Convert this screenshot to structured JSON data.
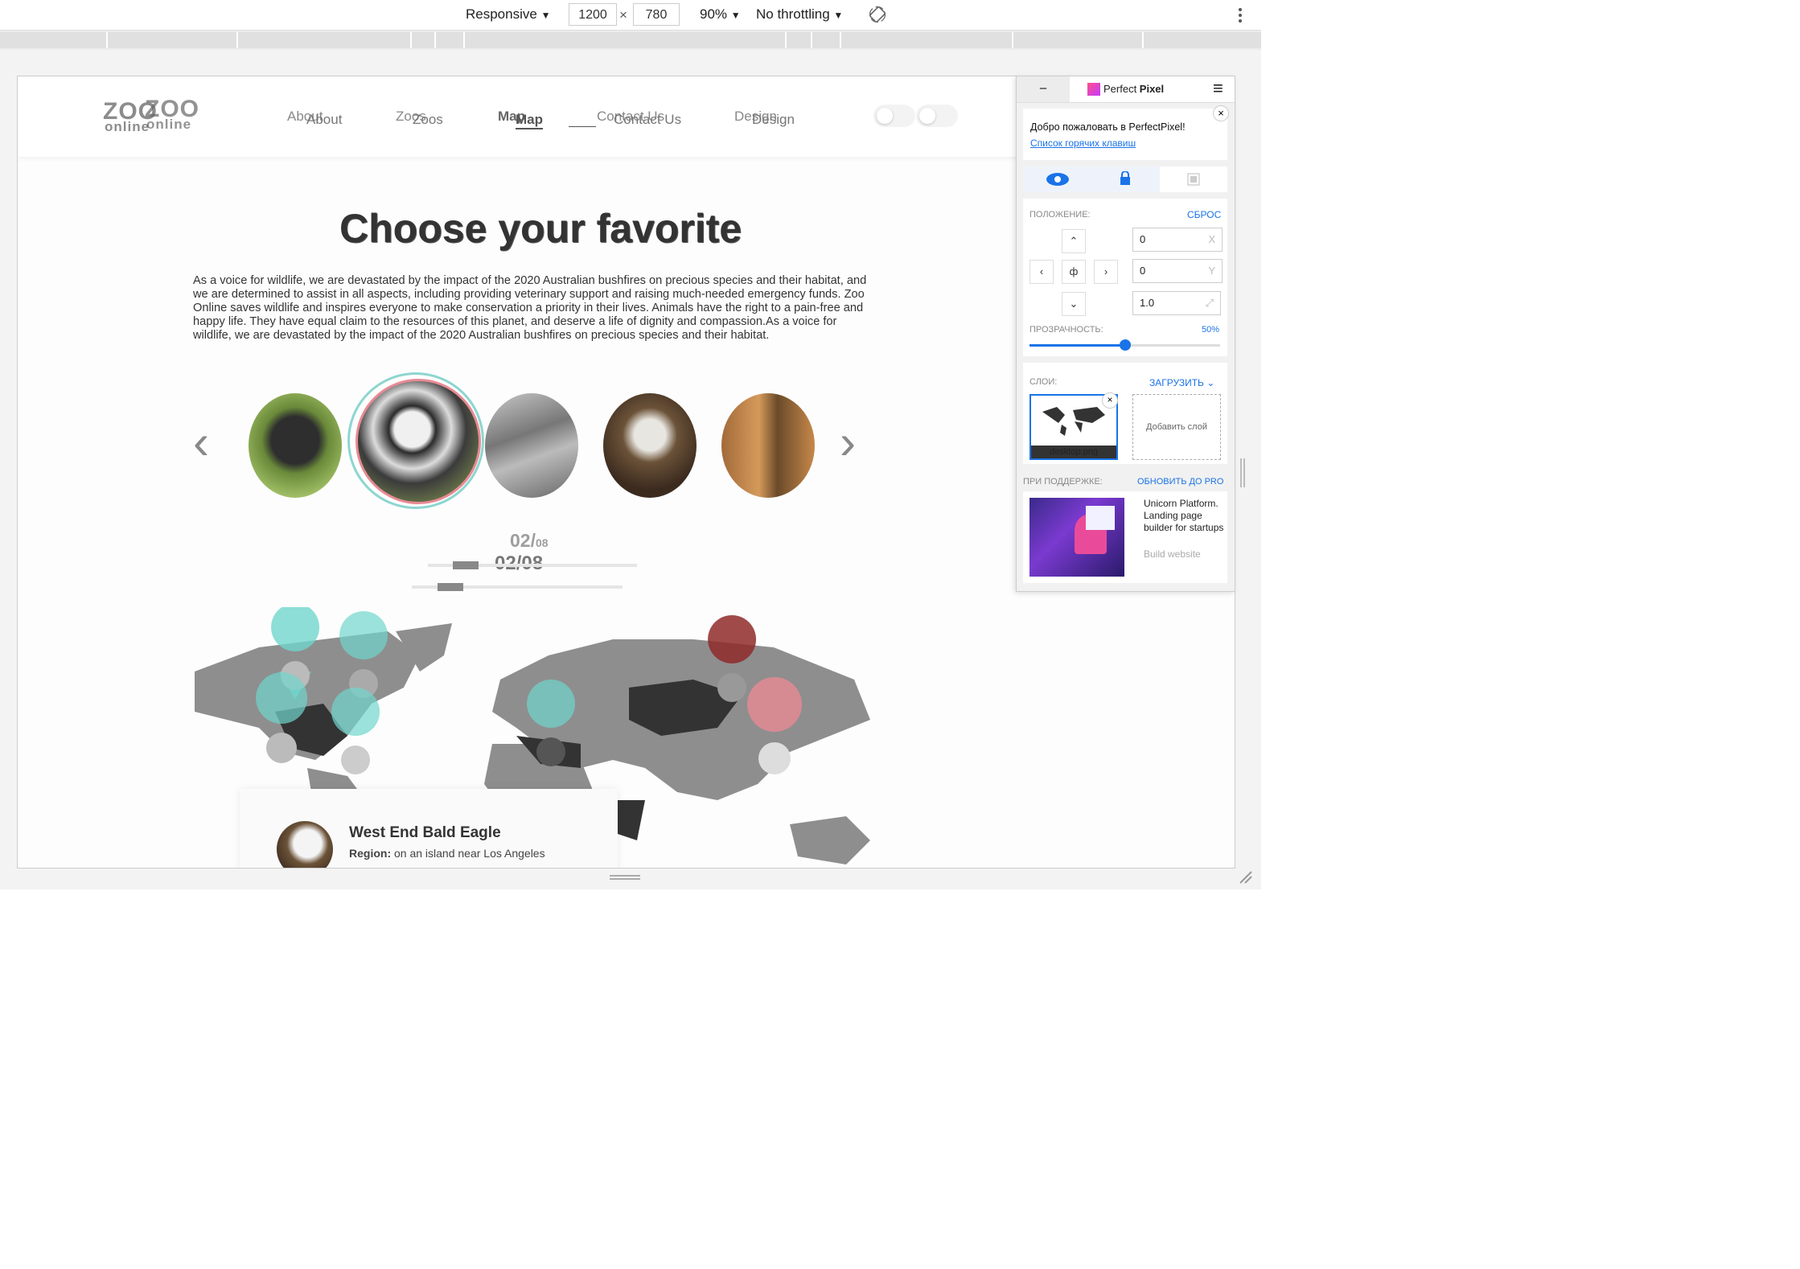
{
  "devtools": {
    "device": "Responsive",
    "width": "1200",
    "height": "780",
    "times": "×",
    "zoom": "90%",
    "throttling": "No throttling",
    "dropdown_glyph": "▼"
  },
  "site": {
    "logo_top": "ZOO",
    "logo_bottom": "online",
    "nav": [
      "About",
      "Zoos",
      "Map",
      "Contact Us",
      "Design"
    ],
    "title": "Choose your favorite",
    "paragraph": "As a voice for wildlife, we are devastated by the impact of the 2020 Australian bushfires on precious species and their habitat, and we are determined to assist in all aspects, including providing veterinary support and raising much-needed emergency funds. Zoo Online saves wildlife and inspires everyone to make conservation a priority in their lives. Animals have the right to a pain-free and happy life. They have equal claim to the resources of this planet, and deserve a life of dignity and compassion.As a voice for wildlife, we are devastated by the impact of the 2020 Australian bushfires on precious species and their habitat.",
    "counter_current": "02/",
    "counter_total": "08",
    "counter_full": "02/08",
    "prev_arrow": "‹",
    "next_arrow": "›",
    "card": {
      "title": "West End Bald Eagle",
      "region_label": "Region:",
      "region_value": "on an island near Los Angeles"
    },
    "colors": {
      "teal": "#6fd6cc",
      "pink": "#e88a94",
      "darkred": "#8f2a2a",
      "map_gray": "#8e8e8e",
      "map_dark": "#333333"
    }
  },
  "perfect_pixel": {
    "minimize": "–",
    "brand_a": "Perfect ",
    "brand_b": "Pixel",
    "menu_icon": "≡",
    "close": "×",
    "welcome": "Добро пожаловать в PerfectPixel!",
    "hotkeys_link": "Список горячих клавиш",
    "position_label": "ПОЛОЖЕНИЕ:",
    "reset": "СБРОС",
    "x_value": "0",
    "x_axis": "X",
    "y_value": "0",
    "y_axis": "Y",
    "scale_value": "1.0",
    "opacity_label": "ПРОЗРАЧНОСТЬ:",
    "opacity_value": "50%",
    "opacity_fraction": 0.5,
    "layers_label": "СЛОИ:",
    "upload": "ЗАГРУЗИТЬ",
    "layer_name": "desktop.png",
    "add_layer": "Добавить слой",
    "support_label": "ПРИ ПОДДЕРЖКЕ:",
    "upgrade": "ОБНОВИТЬ ДО PRO",
    "ad_text": "Unicorn Platform. Landing page builder for startups",
    "ad_link": "Build website"
  }
}
